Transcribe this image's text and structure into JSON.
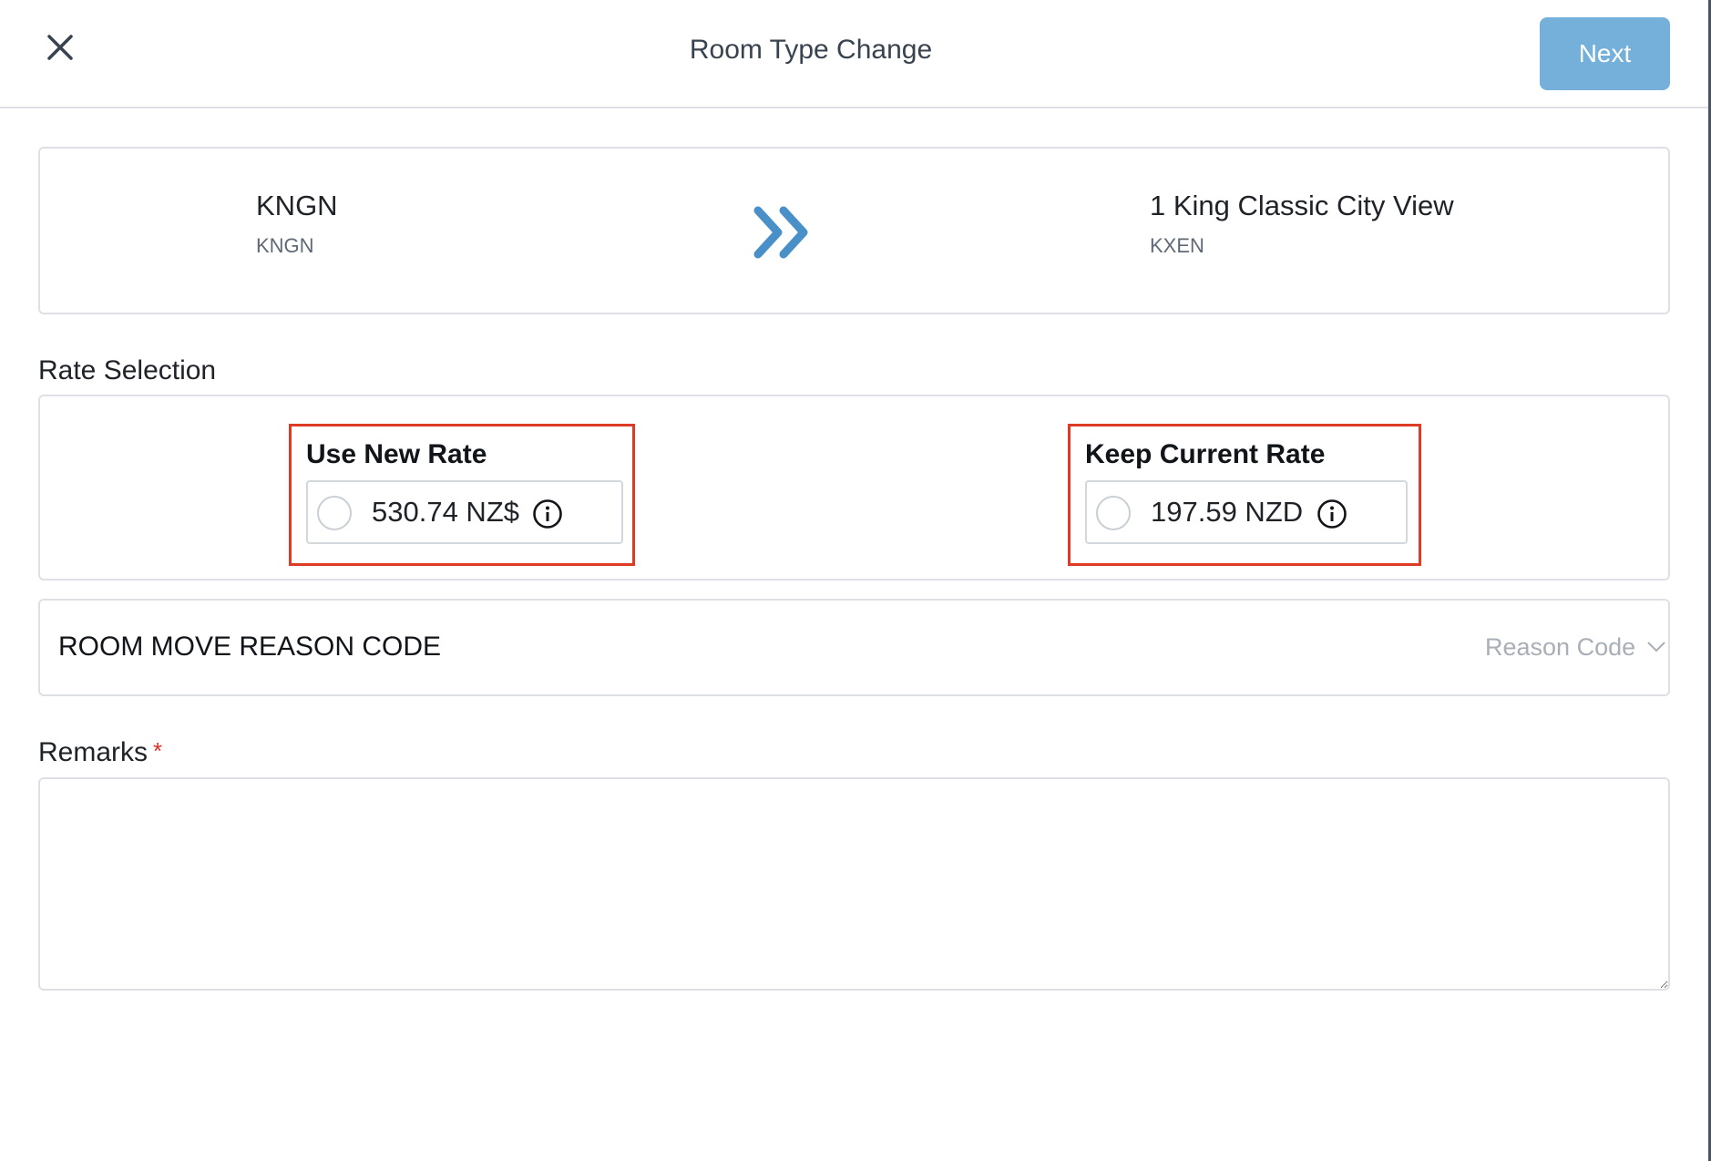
{
  "header": {
    "title": "Room Type Change",
    "next_label": "Next",
    "close_icon": "close-icon"
  },
  "room_change": {
    "from": {
      "name": "KNGN",
      "code": "KNGN"
    },
    "to": {
      "name": "1 King Classic City View",
      "code": "KXEN"
    },
    "arrow_icon": "double-chevron-right-icon",
    "arrow_color": "#4a90c8"
  },
  "rate_selection": {
    "label": "Rate Selection",
    "options": [
      {
        "title": "Use New Rate",
        "value": "530.74 NZ$",
        "selected": false
      },
      {
        "title": "Keep Current Rate",
        "value": "197.59 NZD",
        "selected": false
      }
    ],
    "highlight_color": "#dd3b26"
  },
  "reason": {
    "label": "ROOM MOVE REASON CODE",
    "placeholder": "Reason Code"
  },
  "remarks": {
    "label": "Remarks",
    "required_mark": "*",
    "value": ""
  },
  "colors": {
    "accent": "#74b0da",
    "required": "#d93025"
  }
}
